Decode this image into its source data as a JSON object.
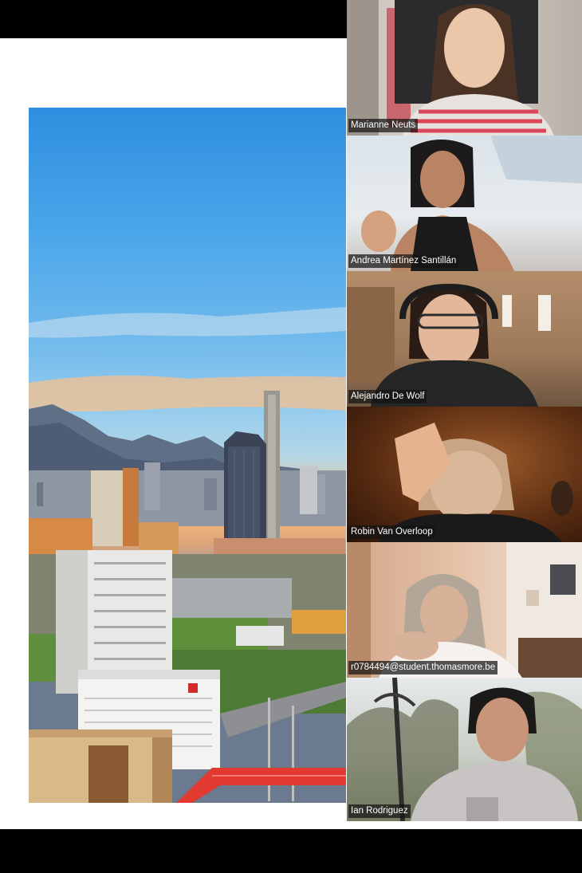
{
  "presentation": {
    "slide_image": "city-skyline-with-mountains",
    "bar_color": "#000000"
  },
  "participants": [
    {
      "name": "Marianne Neuts"
    },
    {
      "name": "Andrea Martínez Santillán"
    },
    {
      "name": "Alejandro De Wolf"
    },
    {
      "name": "Robin Van Overloop"
    },
    {
      "name": "r0784494@student.thomasmore.be"
    },
    {
      "name": "Ian Rodriguez"
    }
  ]
}
